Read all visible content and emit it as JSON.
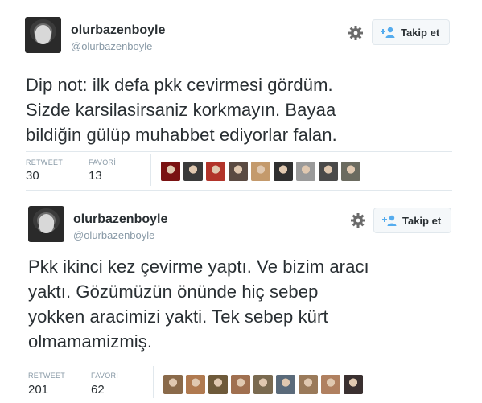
{
  "tweets": [
    {
      "display_name": "olurbazenboyle",
      "handle": "@olurbazenboyle",
      "follow_label": "Takip et",
      "text": "Dip not: ilk defa pkk cevirmesi gördüm.\nSizde karsilasirsaniz korkmayın. Bayaa\nbildiğin gülüp muhabbet ediyorlar falan.",
      "retweet_label": "RETWEET",
      "retweet_count": "30",
      "favorite_label": "FAVORİ",
      "favorite_count": "13",
      "favoriter_avatars": [
        "#7a1212",
        "#3a3a3a",
        "#b2342a",
        "#5a4a42",
        "#c49a6c",
        "#2f2f2f",
        "#9a9a9a",
        "#4a4a4a",
        "#6b6b60"
      ]
    },
    {
      "display_name": "olurbazenboyle",
      "handle": "@olurbazenboyle",
      "follow_label": "Takip et",
      "text": "Pkk ikinci kez çevirme yaptı. Ve bizim aracı\nyaktı. Gözümüzün önünde hiç sebep\nyokken aracimizi yakti. Tek sebep kürt\nolmamamizmiş.",
      "retweet_label": "RETWEET",
      "retweet_count": "201",
      "favorite_label": "FAVORİ",
      "favorite_count": "62",
      "favoriter_avatars": [
        "#8a6a4a",
        "#b07a50",
        "#6e5a3a",
        "#a07050",
        "#7a6a50",
        "#5a6a7a",
        "#9a7a5a",
        "#b08060",
        "#3a3030"
      ]
    }
  ],
  "colors": {
    "text": "#292f33",
    "muted": "#8899a6",
    "border": "#e1e8ed",
    "button_bg": "#f5f8fa",
    "follow_icon": "#55acee"
  },
  "icons": {
    "gear": "gear-icon",
    "follow": "follow-person-plus-icon"
  }
}
